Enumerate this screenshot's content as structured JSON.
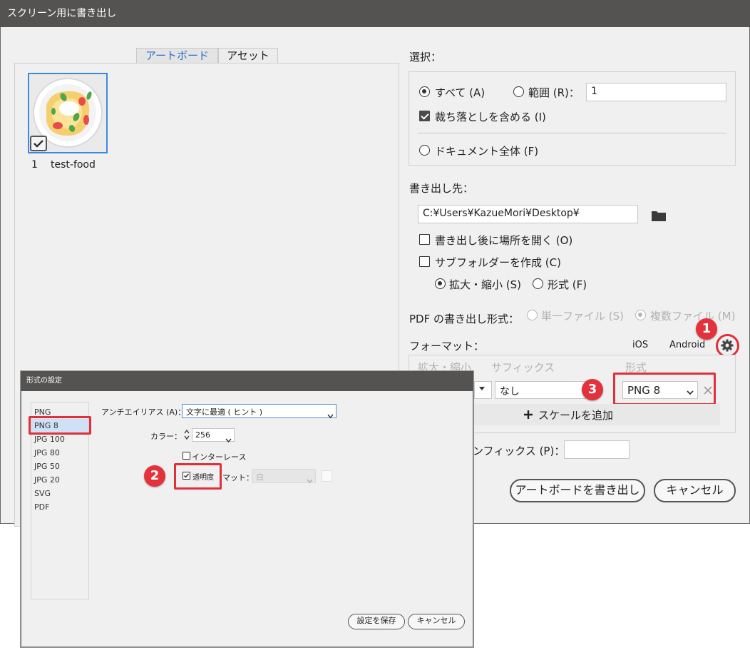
{
  "main_dialog": {
    "title": "スクリーン用に書き出し",
    "tabs": [
      {
        "label": "アートボード"
      },
      {
        "label": "アセット"
      }
    ],
    "artboard": {
      "number": "1",
      "name": "test-food"
    },
    "selection": {
      "label": "選択：",
      "all": "すべて (A)",
      "range": "範囲 (R)：",
      "range_value": "1",
      "include_bleed": "裁ち落としを含める (I)",
      "full_document": "ドキュメント全体 (F)"
    },
    "export_to": {
      "label": "書き出し先：",
      "path": "C:¥Users¥KazueMori¥Desktop¥",
      "open_location": "書き出し後に場所を開く (O)",
      "create_subfolders": "サブフォルダーを作成 (C)",
      "by_scale": "拡大・縮小 (S)",
      "by_format": "形式 (F)"
    },
    "pdf": {
      "label": "PDF の書き出し形式：",
      "single": "単一ファイル (S)",
      "multiple": "複数ファイル (M)"
    },
    "formats": {
      "label": "フォーマット：",
      "ios": "iOS",
      "android": "Android",
      "col_scale": "拡大・縮小",
      "col_suffix": "サフィックス",
      "col_format": "形式",
      "suffix_value": "なし",
      "format_value": "PNG 8",
      "add_scale": "スケールを追加"
    },
    "prefix_label": "ンフィックス (P)：",
    "export_button": "アートボードを書き出し",
    "cancel_button": "キャンセル"
  },
  "format_dialog": {
    "title": "形式の設定",
    "formats": [
      "PNG",
      "PNG 8",
      "JPG 100",
      "JPG 80",
      "JPG 50",
      "JPG 20",
      "SVG",
      "PDF"
    ],
    "selected_format": "PNG 8",
    "antialias_label": "アンチエイリアス (A)：",
    "antialias_value": "文字に最適 ( ヒント )",
    "color_label": "カラー：",
    "color_value": "256",
    "interlace": "インターレース",
    "transparency": "透明度",
    "matte_label": "マット：",
    "matte_value": "白",
    "save_button": "設定を保存",
    "cancel_button": "キャンセル"
  },
  "annotations": [
    "1",
    "2",
    "3"
  ],
  "colors": {
    "titlebar": "#555351",
    "accent_blue": "#2a6fcb",
    "annotation_red": "#e3323b",
    "selected_item": "#cfe0f7"
  }
}
